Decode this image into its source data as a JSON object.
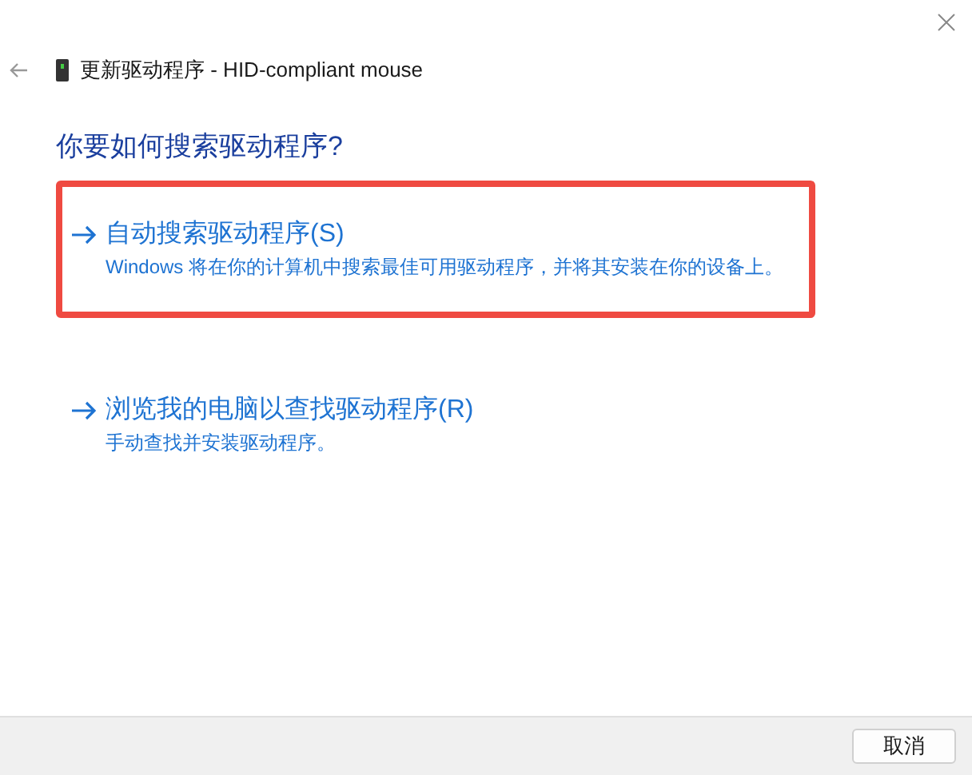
{
  "window": {
    "title": "更新驱动程序 - HID-compliant mouse"
  },
  "heading": "你要如何搜索驱动程序?",
  "options": [
    {
      "title": "自动搜索驱动程序(S)",
      "description": "Windows 将在你的计算机中搜索最佳可用驱动程序，并将其安装在你的设备上。",
      "highlighted": true
    },
    {
      "title": "浏览我的电脑以查找驱动程序(R)",
      "description": "手动查找并安装驱动程序。",
      "highlighted": false
    }
  ],
  "buttons": [
    "取消"
  ]
}
